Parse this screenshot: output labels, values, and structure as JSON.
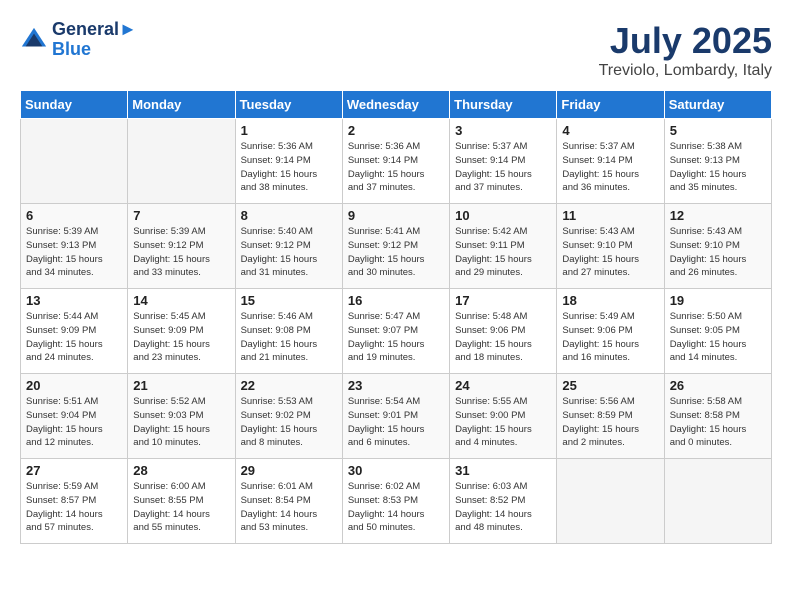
{
  "header": {
    "logo_line1": "General",
    "logo_line2": "Blue",
    "month_title": "July 2025",
    "location": "Treviolo, Lombardy, Italy"
  },
  "days_of_week": [
    "Sunday",
    "Monday",
    "Tuesday",
    "Wednesday",
    "Thursday",
    "Friday",
    "Saturday"
  ],
  "weeks": [
    [
      {
        "day": "",
        "info": ""
      },
      {
        "day": "",
        "info": ""
      },
      {
        "day": "1",
        "info": "Sunrise: 5:36 AM\nSunset: 9:14 PM\nDaylight: 15 hours\nand 38 minutes."
      },
      {
        "day": "2",
        "info": "Sunrise: 5:36 AM\nSunset: 9:14 PM\nDaylight: 15 hours\nand 37 minutes."
      },
      {
        "day": "3",
        "info": "Sunrise: 5:37 AM\nSunset: 9:14 PM\nDaylight: 15 hours\nand 37 minutes."
      },
      {
        "day": "4",
        "info": "Sunrise: 5:37 AM\nSunset: 9:14 PM\nDaylight: 15 hours\nand 36 minutes."
      },
      {
        "day": "5",
        "info": "Sunrise: 5:38 AM\nSunset: 9:13 PM\nDaylight: 15 hours\nand 35 minutes."
      }
    ],
    [
      {
        "day": "6",
        "info": "Sunrise: 5:39 AM\nSunset: 9:13 PM\nDaylight: 15 hours\nand 34 minutes."
      },
      {
        "day": "7",
        "info": "Sunrise: 5:39 AM\nSunset: 9:12 PM\nDaylight: 15 hours\nand 33 minutes."
      },
      {
        "day": "8",
        "info": "Sunrise: 5:40 AM\nSunset: 9:12 PM\nDaylight: 15 hours\nand 31 minutes."
      },
      {
        "day": "9",
        "info": "Sunrise: 5:41 AM\nSunset: 9:12 PM\nDaylight: 15 hours\nand 30 minutes."
      },
      {
        "day": "10",
        "info": "Sunrise: 5:42 AM\nSunset: 9:11 PM\nDaylight: 15 hours\nand 29 minutes."
      },
      {
        "day": "11",
        "info": "Sunrise: 5:43 AM\nSunset: 9:10 PM\nDaylight: 15 hours\nand 27 minutes."
      },
      {
        "day": "12",
        "info": "Sunrise: 5:43 AM\nSunset: 9:10 PM\nDaylight: 15 hours\nand 26 minutes."
      }
    ],
    [
      {
        "day": "13",
        "info": "Sunrise: 5:44 AM\nSunset: 9:09 PM\nDaylight: 15 hours\nand 24 minutes."
      },
      {
        "day": "14",
        "info": "Sunrise: 5:45 AM\nSunset: 9:09 PM\nDaylight: 15 hours\nand 23 minutes."
      },
      {
        "day": "15",
        "info": "Sunrise: 5:46 AM\nSunset: 9:08 PM\nDaylight: 15 hours\nand 21 minutes."
      },
      {
        "day": "16",
        "info": "Sunrise: 5:47 AM\nSunset: 9:07 PM\nDaylight: 15 hours\nand 19 minutes."
      },
      {
        "day": "17",
        "info": "Sunrise: 5:48 AM\nSunset: 9:06 PM\nDaylight: 15 hours\nand 18 minutes."
      },
      {
        "day": "18",
        "info": "Sunrise: 5:49 AM\nSunset: 9:06 PM\nDaylight: 15 hours\nand 16 minutes."
      },
      {
        "day": "19",
        "info": "Sunrise: 5:50 AM\nSunset: 9:05 PM\nDaylight: 15 hours\nand 14 minutes."
      }
    ],
    [
      {
        "day": "20",
        "info": "Sunrise: 5:51 AM\nSunset: 9:04 PM\nDaylight: 15 hours\nand 12 minutes."
      },
      {
        "day": "21",
        "info": "Sunrise: 5:52 AM\nSunset: 9:03 PM\nDaylight: 15 hours\nand 10 minutes."
      },
      {
        "day": "22",
        "info": "Sunrise: 5:53 AM\nSunset: 9:02 PM\nDaylight: 15 hours\nand 8 minutes."
      },
      {
        "day": "23",
        "info": "Sunrise: 5:54 AM\nSunset: 9:01 PM\nDaylight: 15 hours\nand 6 minutes."
      },
      {
        "day": "24",
        "info": "Sunrise: 5:55 AM\nSunset: 9:00 PM\nDaylight: 15 hours\nand 4 minutes."
      },
      {
        "day": "25",
        "info": "Sunrise: 5:56 AM\nSunset: 8:59 PM\nDaylight: 15 hours\nand 2 minutes."
      },
      {
        "day": "26",
        "info": "Sunrise: 5:58 AM\nSunset: 8:58 PM\nDaylight: 15 hours\nand 0 minutes."
      }
    ],
    [
      {
        "day": "27",
        "info": "Sunrise: 5:59 AM\nSunset: 8:57 PM\nDaylight: 14 hours\nand 57 minutes."
      },
      {
        "day": "28",
        "info": "Sunrise: 6:00 AM\nSunset: 8:55 PM\nDaylight: 14 hours\nand 55 minutes."
      },
      {
        "day": "29",
        "info": "Sunrise: 6:01 AM\nSunset: 8:54 PM\nDaylight: 14 hours\nand 53 minutes."
      },
      {
        "day": "30",
        "info": "Sunrise: 6:02 AM\nSunset: 8:53 PM\nDaylight: 14 hours\nand 50 minutes."
      },
      {
        "day": "31",
        "info": "Sunrise: 6:03 AM\nSunset: 8:52 PM\nDaylight: 14 hours\nand 48 minutes."
      },
      {
        "day": "",
        "info": ""
      },
      {
        "day": "",
        "info": ""
      }
    ]
  ]
}
